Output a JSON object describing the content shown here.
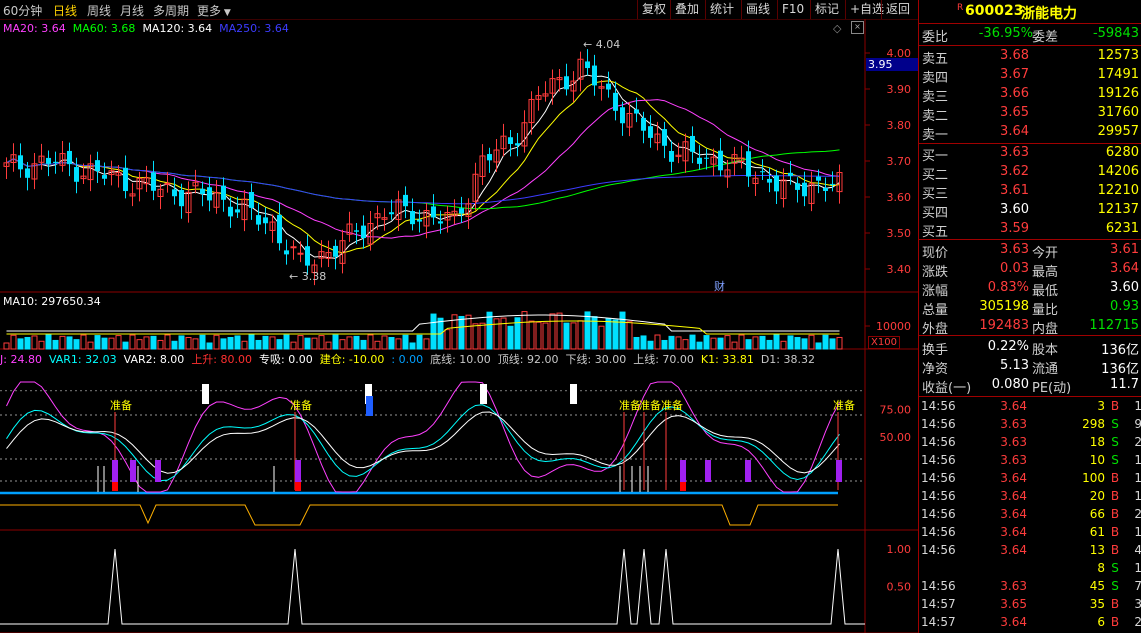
{
  "toolbar": {
    "periods": [
      "60分钟",
      "日线",
      "周线",
      "月线",
      "多周期",
      "更多"
    ],
    "buttons": [
      "复权",
      "叠加",
      "统计",
      "画线",
      "F10",
      "标记",
      "+自选",
      "返回"
    ]
  },
  "colors": {
    "up": "#ff3c3c",
    "down": "#00e0ff",
    "ma20": "#ffffff",
    "ma60": "#ffff00",
    "ma120": "#ff40ff",
    "ma250": "#00ff00",
    "bg": "#000000",
    "grid": "#8b0000"
  },
  "price_panel": {
    "legend": [
      {
        "text": "MA20: 3.64",
        "color": "#ff40ff"
      },
      {
        "text": "MA60: 3.68",
        "color": "#00ff00"
      },
      {
        "text": "MA120: 3.64",
        "color": "#ffffff"
      },
      {
        "text": "MA250: 3.64",
        "color": "#3c3cff"
      }
    ],
    "y_ticks": [
      "4.00",
      "3.90",
      "3.80",
      "3.70",
      "3.60",
      "3.50",
      "3.40"
    ],
    "current_price_tag": "3.95",
    "high_label": "4.04",
    "low_label": "3.38",
    "financial_marker": "财"
  },
  "volume_panel": {
    "legend": "MA10: 297650.34",
    "y_tick": "10000",
    "unit": "X100"
  },
  "indicator_panel": {
    "legend": [
      {
        "text": "J: 24.80",
        "color": "#ff40ff"
      },
      {
        "text": "VAR1: 32.03",
        "color": "#00ffff"
      },
      {
        "text": "VAR2: 8.00",
        "color": "#ffffff"
      },
      {
        "text": "上升: 80.00",
        "color": "#ff3030"
      },
      {
        "text": "专吸: 0.00",
        "color": "#ffffff"
      },
      {
        "text": "建仓: -10.00",
        "color": "#ffff00"
      },
      {
        "text": ": 0.00",
        "color": "#00a0ff"
      },
      {
        "text": "底线: 10.00",
        "color": "#c8c8c8"
      },
      {
        "text": "顶线: 92.00",
        "color": "#c8c8c8"
      },
      {
        "text": "下线: 30.00",
        "color": "#c8c8c8"
      },
      {
        "text": "上线: 70.00",
        "color": "#c8c8c8"
      },
      {
        "text": "K1: 33.81",
        "color": "#ffff00"
      },
      {
        "text": "D1: 38.32",
        "color": "#c8c8c8"
      }
    ],
    "y_ticks": [
      "75.00",
      "50.00"
    ],
    "signal_label": "准备"
  },
  "signal_panel": {
    "y_ticks": [
      "1.00",
      "0.50"
    ]
  },
  "quote": {
    "code": "600023",
    "name": "浙能电力",
    "r_badge": "R",
    "weibi_label": "委比",
    "weibi": "-36.95%",
    "weicha_label": "委差",
    "weicha": "-59843",
    "asks": [
      {
        "label": "卖五",
        "price": "3.68",
        "vol": "12573"
      },
      {
        "label": "卖四",
        "price": "3.67",
        "vol": "17491"
      },
      {
        "label": "卖三",
        "price": "3.66",
        "vol": "19126"
      },
      {
        "label": "卖二",
        "price": "3.65",
        "vol": "31760"
      },
      {
        "label": "卖一",
        "price": "3.64",
        "vol": "29957"
      }
    ],
    "bids": [
      {
        "label": "买一",
        "price": "3.63",
        "vol": "6280"
      },
      {
        "label": "买二",
        "price": "3.62",
        "vol": "14206"
      },
      {
        "label": "买三",
        "price": "3.61",
        "vol": "12210"
      },
      {
        "label": "买四",
        "price": "3.60",
        "vol": "12137"
      },
      {
        "label": "买五",
        "price": "3.59",
        "vol": "6231"
      }
    ],
    "stats": [
      {
        "l1": "现价",
        "v1": "3.63",
        "l2": "今开",
        "v2": "3.61"
      },
      {
        "l1": "涨跌",
        "v1": "0.03",
        "l2": "最高",
        "v2": "3.64"
      },
      {
        "l1": "涨幅",
        "v1": "0.83%",
        "l2": "最低",
        "v2": "3.60"
      },
      {
        "l1": "总量",
        "v1": "305198",
        "l2": "量比",
        "v2": "0.93"
      },
      {
        "l1": "外盘",
        "v1": "192483",
        "l2": "内盘",
        "v2": "112715"
      }
    ],
    "stats2": [
      {
        "l1": "换手",
        "v1": "0.22%",
        "l2": "股本",
        "v2": "136亿"
      },
      {
        "l1": "净资",
        "v1": "5.13",
        "l2": "流通",
        "v2": "136亿"
      },
      {
        "l1": "收益(一)",
        "v1": "0.080",
        "l2": "PE(动)",
        "v2": "11.7"
      }
    ],
    "ticks": [
      {
        "t": "14:56",
        "p": "3.64",
        "v": "3",
        "f": "B",
        "n": "1"
      },
      {
        "t": "14:56",
        "p": "3.63",
        "v": "298",
        "f": "S",
        "n": "9"
      },
      {
        "t": "14:56",
        "p": "3.63",
        "v": "18",
        "f": "S",
        "n": "2"
      },
      {
        "t": "14:56",
        "p": "3.63",
        "v": "10",
        "f": "S",
        "n": "1"
      },
      {
        "t": "14:56",
        "p": "3.64",
        "v": "100",
        "f": "B",
        "n": "1"
      },
      {
        "t": "14:56",
        "p": "3.64",
        "v": "20",
        "f": "B",
        "n": "1"
      },
      {
        "t": "14:56",
        "p": "3.64",
        "v": "66",
        "f": "B",
        "n": "2"
      },
      {
        "t": "14:56",
        "p": "3.64",
        "v": "61",
        "f": "B",
        "n": "1"
      },
      {
        "t": "14:56",
        "p": "3.64",
        "v": "13",
        "f": "B",
        "n": "4"
      },
      {
        "t": "",
        "p": "",
        "v": "8",
        "f": "S",
        "n": "1"
      },
      {
        "t": "14:56",
        "p": "3.63",
        "v": "45",
        "f": "S",
        "n": "7"
      },
      {
        "t": "14:57",
        "p": "3.65",
        "v": "35",
        "f": "B",
        "n": "3"
      },
      {
        "t": "14:57",
        "p": "3.64",
        "v": "6",
        "f": "B",
        "n": "2"
      }
    ]
  }
}
